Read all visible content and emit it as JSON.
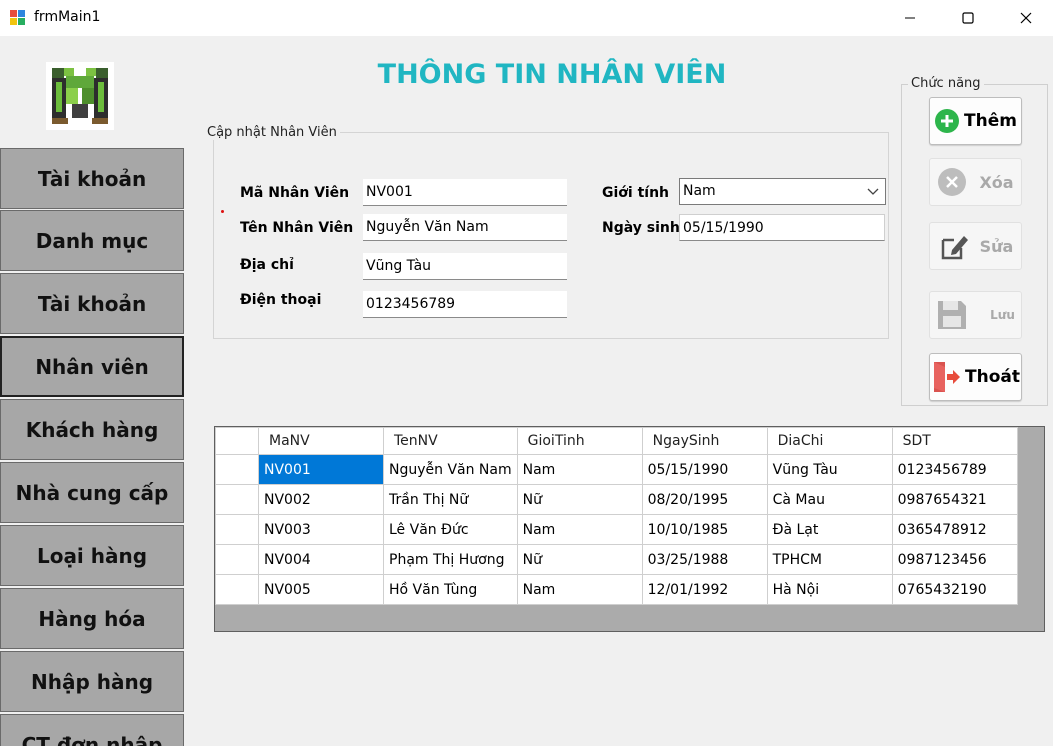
{
  "window": {
    "title": "frmMain1"
  },
  "menu": {
    "items": [
      {
        "label": "Tài khoản",
        "active": false
      },
      {
        "label": "Danh mục",
        "active": false
      },
      {
        "label": "Tài khoản",
        "active": false
      },
      {
        "label": "Nhân viên",
        "active": true
      },
      {
        "label": "Khách hàng",
        "active": false
      },
      {
        "label": "Nhà cung cấp",
        "active": false
      },
      {
        "label": "Loại hàng",
        "active": false
      },
      {
        "label": "Hàng hóa",
        "active": false
      },
      {
        "label": "Nhập hàng",
        "active": false
      },
      {
        "label": "CT đơn nhập",
        "active": false
      }
    ]
  },
  "page": {
    "heading": "THÔNG TIN NHÂN VIÊN"
  },
  "form": {
    "group_title": "Cập nhật Nhân Viên",
    "ma_nv_label": "Mã Nhân Viên",
    "ma_nv_value": "NV001",
    "ten_nv_label": "Tên Nhân Viên",
    "ten_nv_value": "Nguyễn Văn Nam",
    "dia_chi_label": "Địa chỉ",
    "dia_chi_value": "Vũng Tàu",
    "dien_thoai_label": "Điện thoại",
    "dien_thoai_value": "0123456789",
    "gioi_tinh_label": "Giới tính",
    "gioi_tinh_value": "Nam",
    "ngay_sinh_label": "Ngày sinh",
    "ngay_sinh_value": "05/15/1990"
  },
  "functions": {
    "group_title": "Chức năng",
    "them": "Thêm",
    "xoa": "Xóa",
    "sua": "Sửa",
    "luu": "Lưu",
    "thoat": "Thoát"
  },
  "grid": {
    "columns": [
      "MaNV",
      "TenNV",
      "GioiTinh",
      "NgaySinh",
      "DiaChi",
      "SDT"
    ],
    "rows": [
      [
        "NV001",
        "Nguyễn Văn Nam",
        "Nam",
        "05/15/1990",
        "Vũng Tàu",
        "0123456789"
      ],
      [
        "NV002",
        "Trần Thị Nữ",
        "Nữ",
        "08/20/1995",
        "Cà Mau",
        "0987654321"
      ],
      [
        "NV003",
        "Lê Văn Đức",
        "Nam",
        "10/10/1985",
        "Đà Lạt",
        "0365478912"
      ],
      [
        "NV004",
        "Phạm Thị Hương",
        "Nữ",
        "03/25/1988",
        "TPHCM",
        "0987123456"
      ],
      [
        "NV005",
        "Hồ Văn Tùng",
        "Nam",
        "12/01/1992",
        "Hà Nội",
        "0765432190"
      ]
    ]
  },
  "colors": {
    "heading": "#20b6c2",
    "selection": "#0078d7",
    "menu_bg": "#a7a7a7"
  }
}
